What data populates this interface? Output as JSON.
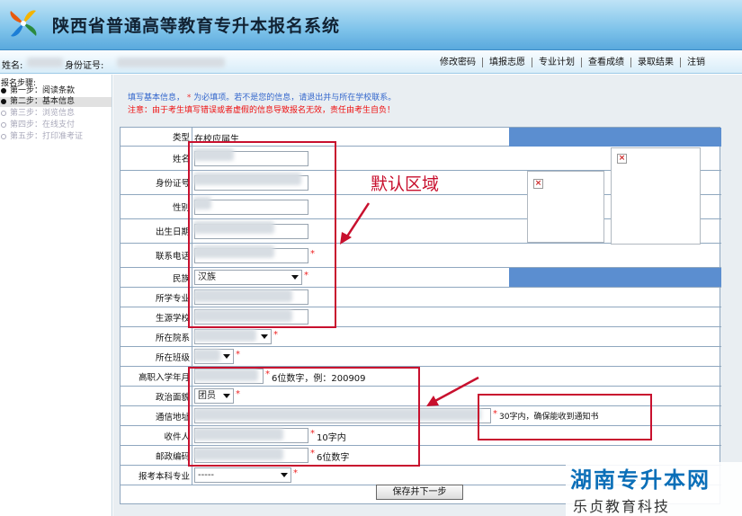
{
  "header": {
    "title": "陕西省普通高等教育专升本报名系统"
  },
  "userbar": {
    "name_label": "姓名:",
    "id_label": "身份证号:",
    "nav": [
      "修改密码",
      "填报志愿",
      "专业计划",
      "查看成绩",
      "录取结果",
      "注销"
    ]
  },
  "sidebar": {
    "title": "报名步骤:",
    "steps": [
      {
        "label": "第一步：阅读条款",
        "state": "done"
      },
      {
        "label": "第二步：基本信息",
        "state": "current"
      },
      {
        "label": "第三步：浏览信息",
        "state": "todo"
      },
      {
        "label": "第四步：在线支付",
        "state": "todo"
      },
      {
        "label": "第五步：打印准考证",
        "state": "todo"
      }
    ]
  },
  "notices": {
    "line1_a": "填写基本信息，",
    "line1_star": "*",
    "line1_b": "为必填项。若不是您的信息，请退出并与所在学校联系。",
    "line2": "注意：由于考生填写错误或者虚假的信息导致报名无效，责任由考生自负！"
  },
  "form": {
    "type_label": "类型",
    "type_value": "在校应届生",
    "name_label": "姓名",
    "id_label": "身份证号",
    "gender_label": "性别",
    "birth_label": "出生日期",
    "phone_label": "联系电话",
    "ethnic_label": "民族",
    "ethnic_value": "汉族",
    "major_label": "所学专业",
    "school_label": "生源学校",
    "dept_label": "所在院系",
    "class_label": "所在班级",
    "enroll_label": "高职入学年月",
    "enroll_hint": "6位数字，例：200909",
    "politics_label": "政治面貌",
    "politics_value": "团员",
    "address_label": "通信地址",
    "address_hint": "30字内，确保能收到通知书",
    "receiver_label": "收件人",
    "receiver_hint": "10字内",
    "postcode_label": "邮政编码",
    "postcode_hint": "6位数字",
    "apply_major_label": "报考本科专业",
    "apply_major_value": "-----",
    "required_mark": "*",
    "photo_x": "×"
  },
  "buttons": {
    "save_next": "保存并下一步"
  },
  "annotation": {
    "default_area": "默认区域"
  },
  "watermark": {
    "line1": "湖南专升本网",
    "line2": "乐贞教育科技"
  },
  "colors": {
    "header": "#7ec3ea",
    "annotation": "#c8102e",
    "required": "#e22",
    "notice_blue": "#3366cc",
    "bluebar": "#5b8ed0",
    "watermark": "#0b6fb8"
  }
}
